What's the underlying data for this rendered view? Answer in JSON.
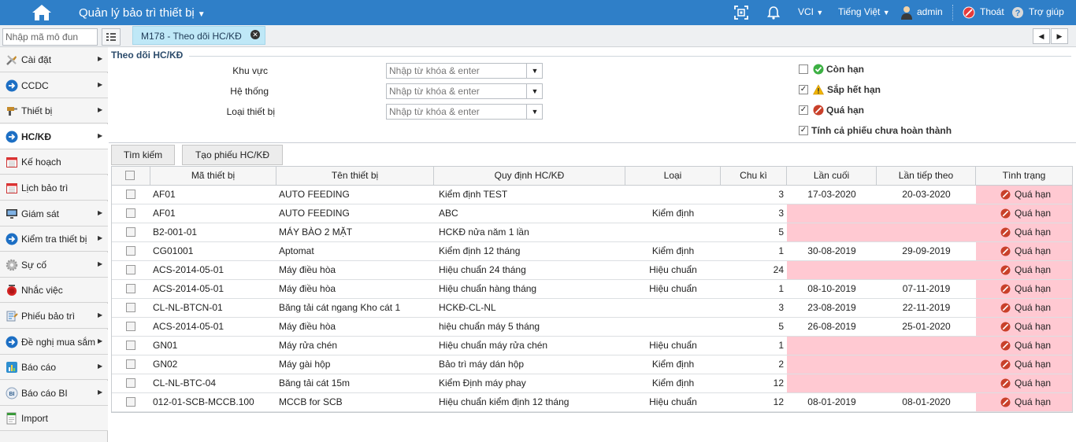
{
  "header": {
    "app_title": "Quản lý bảo trì thiết bị",
    "company": "VCI",
    "language": "Tiếng Việt",
    "user": "admin",
    "logout": "Thoát",
    "help": "Trợ giúp"
  },
  "subbar": {
    "module_placeholder": "Nhập mã mô đun",
    "active_tab": "M178 - Theo dõi HC/KĐ"
  },
  "sidebar": {
    "items": [
      {
        "label": "Cài đặt",
        "icon": "tools-icon",
        "arrow": true
      },
      {
        "label": "CCDC",
        "icon": "arrow-circle-icon",
        "arrow": true
      },
      {
        "label": "Thiết bị",
        "icon": "drill-icon",
        "arrow": true
      },
      {
        "label": "HC/KĐ",
        "icon": "arrow-circle-icon",
        "arrow": true
      },
      {
        "label": "Kế hoạch",
        "icon": "calendar-icon",
        "arrow": false
      },
      {
        "label": "Lịch bảo trì",
        "icon": "calendar-icon",
        "arrow": false
      },
      {
        "label": "Giám sát",
        "icon": "monitor-icon",
        "arrow": true
      },
      {
        "label": "Kiểm tra thiết bị",
        "icon": "arrow-circle-icon",
        "arrow": true
      },
      {
        "label": "Sự cố",
        "icon": "gear-icon",
        "arrow": true
      },
      {
        "label": "Nhắc việc",
        "icon": "alarm-icon",
        "arrow": false
      },
      {
        "label": "Phiếu bảo trì",
        "icon": "form-icon",
        "arrow": true
      },
      {
        "label": "Đề nghị mua sắm",
        "icon": "arrow-circle-icon",
        "arrow": true
      },
      {
        "label": "Báo cáo",
        "icon": "report-icon",
        "arrow": true
      },
      {
        "label": "Báo cáo BI",
        "icon": "bi-icon",
        "arrow": true
      },
      {
        "label": "Import",
        "icon": "import-icon",
        "arrow": false
      }
    ]
  },
  "filters": {
    "section_title": "Theo dõi HC/KĐ",
    "fields": [
      {
        "label": "Khu vực",
        "placeholder": "Nhập từ khóa & enter"
      },
      {
        "label": "Hệ thống",
        "placeholder": "Nhập từ khóa & enter"
      },
      {
        "label": "Loại thiết bị",
        "placeholder": "Nhập từ khóa & enter"
      }
    ],
    "statuses": [
      {
        "label": "Còn hạn",
        "checked": false,
        "color": "#3cb043"
      },
      {
        "label": "Sắp hết hạn",
        "checked": true,
        "color": "#f0b400"
      },
      {
        "label": "Quá hạn",
        "checked": true,
        "color": "#c9402a"
      },
      {
        "label": "Tính cả phiếu chưa hoàn thành",
        "checked": true
      }
    ]
  },
  "actions": {
    "search": "Tìm kiếm",
    "create": "Tạo phiếu HC/KĐ"
  },
  "table": {
    "columns": [
      "Mã thiết bị",
      "Tên thiết bị",
      "Quy định HC/KĐ",
      "Loại",
      "Chu kì",
      "Lần cuối",
      "Lần tiếp theo",
      "Tình trạng"
    ],
    "rows": [
      {
        "code": "AF01",
        "name": "AUTO FEEDING",
        "rule": "Kiểm định TEST",
        "type": "",
        "cycle": "3",
        "last": "17-03-2020",
        "next": "20-03-2020",
        "status": "Quá hạn",
        "blank_dates": false
      },
      {
        "code": "AF01",
        "name": "AUTO FEEDING",
        "rule": "ABC",
        "type": "Kiểm định",
        "cycle": "3",
        "last": "",
        "next": "",
        "status": "Quá hạn",
        "blank_dates": true
      },
      {
        "code": "B2-001-01",
        "name": "MÁY BÀO 2 MẶT",
        "rule": "HCKĐ nửa năm 1 lần",
        "type": "",
        "cycle": "5",
        "last": "",
        "next": "",
        "status": "Quá hạn",
        "blank_dates": true
      },
      {
        "code": "CG01001",
        "name": "Aptomat",
        "rule": "Kiểm định 12 tháng",
        "type": "Kiểm định",
        "cycle": "1",
        "last": "30-08-2019",
        "next": "29-09-2019",
        "status": "Quá hạn",
        "blank_dates": false
      },
      {
        "code": "ACS-2014-05-01",
        "name": "Máy điều hòa",
        "rule": "Hiệu chuẩn 24 tháng",
        "type": "Hiệu chuẩn",
        "cycle": "24",
        "last": "",
        "next": "",
        "status": "Quá hạn",
        "blank_dates": true
      },
      {
        "code": "ACS-2014-05-01",
        "name": "Máy điều hòa",
        "rule": "Hiệu chuẩn hàng tháng",
        "type": "Hiệu chuẩn",
        "cycle": "1",
        "last": "08-10-2019",
        "next": "07-11-2019",
        "status": "Quá hạn",
        "blank_dates": false
      },
      {
        "code": "CL-NL-BTCN-01",
        "name": "Băng tải cát ngang Kho cát 1",
        "rule": "HCKĐ-CL-NL",
        "type": "",
        "cycle": "3",
        "last": "23-08-2019",
        "next": "22-11-2019",
        "status": "Quá hạn",
        "blank_dates": false
      },
      {
        "code": "ACS-2014-05-01",
        "name": "Máy điều hòa",
        "rule": "hiệu chuẩn máy 5 tháng",
        "type": "",
        "cycle": "5",
        "last": "26-08-2019",
        "next": "25-01-2020",
        "status": "Quá hạn",
        "blank_dates": false
      },
      {
        "code": "GN01",
        "name": "Máy rửa chén",
        "rule": "Hiệu chuẩn máy rửa chén",
        "type": "Hiệu chuẩn",
        "cycle": "1",
        "last": "",
        "next": "",
        "status": "Quá hạn",
        "blank_dates": true
      },
      {
        "code": "GN02",
        "name": "Máy gài hộp",
        "rule": "Bảo trì máy dán hộp",
        "type": "Kiểm định",
        "cycle": "2",
        "last": "",
        "next": "",
        "status": "Quá hạn",
        "blank_dates": true
      },
      {
        "code": "CL-NL-BTC-04",
        "name": "Băng tải cát 15m",
        "rule": "Kiểm Định máy phay",
        "type": "Kiểm định",
        "cycle": "12",
        "last": "",
        "next": "",
        "status": "Quá hạn",
        "blank_dates": true
      },
      {
        "code": "012-01-SCB-MCCB.100",
        "name": "MCCB for SCB",
        "rule": "Hiệu chuẩn kiểm định 12 tháng",
        "type": "Hiệu chuẩn",
        "cycle": "12",
        "last": "08-01-2019",
        "next": "08-01-2020",
        "status": "Quá hạn",
        "blank_dates": false
      }
    ]
  },
  "colors": {
    "topbar": "#2f7fc8",
    "overdue_bg": "#ffc9d2",
    "tab_active": "#bfe8f7"
  }
}
